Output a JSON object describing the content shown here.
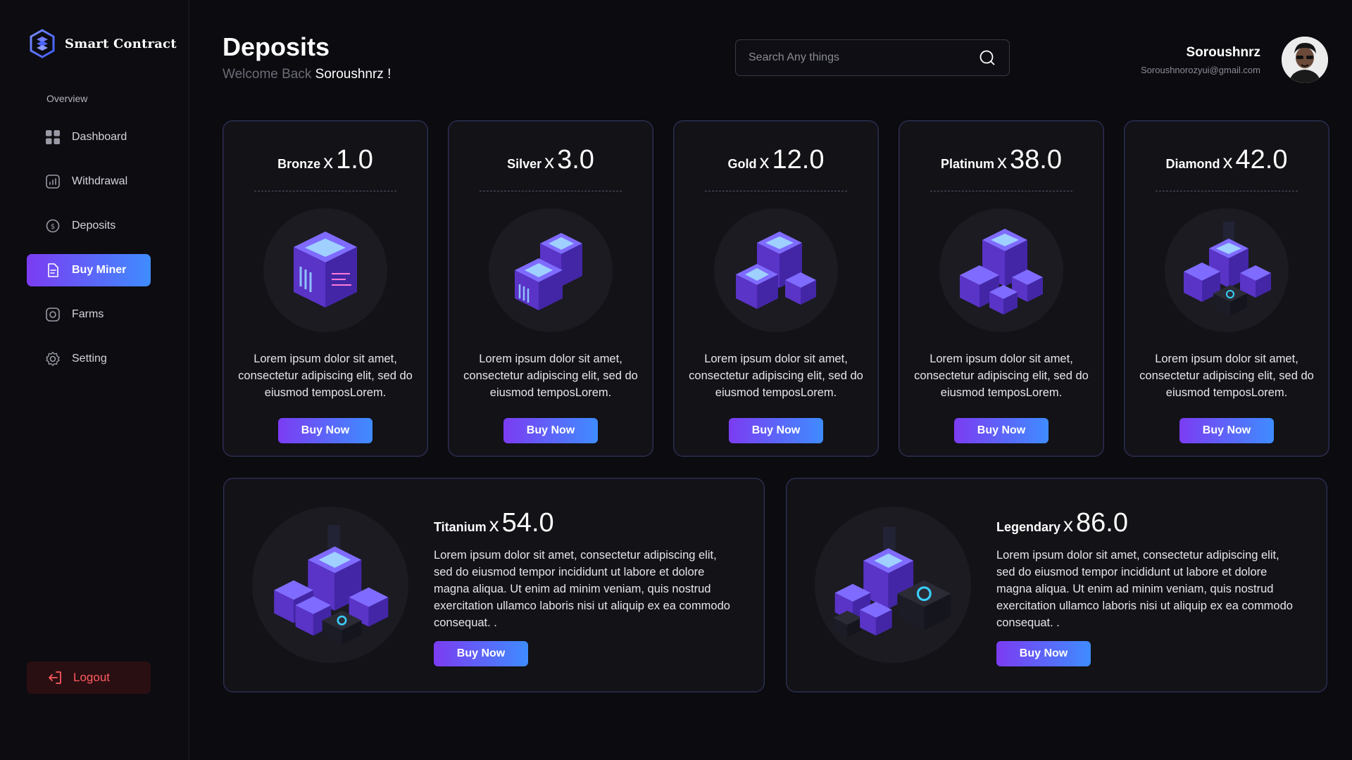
{
  "brand": {
    "name": "Smart Contract",
    "icon": "hexagon-logo-icon"
  },
  "sidebar": {
    "section_label": "Overview",
    "items": [
      {
        "label": "Dashboard",
        "icon": "grid-icon"
      },
      {
        "label": "Withdrawal",
        "icon": "chart-icon"
      },
      {
        "label": "Deposits",
        "icon": "coin-icon"
      },
      {
        "label": "Buy Miner",
        "icon": "document-icon",
        "active": true
      },
      {
        "label": "Farms",
        "icon": "target-icon"
      },
      {
        "label": "Setting",
        "icon": "gear-icon"
      }
    ],
    "logout_label": "Logout"
  },
  "header": {
    "title": "Deposits",
    "welcome_prefix": "Welcome Back",
    "welcome_name": "Soroushnrz !",
    "search_placeholder": "Search Any things"
  },
  "user": {
    "name": "Soroushnrz",
    "email": "Soroushnorozyui@gmail.com"
  },
  "tiers": [
    {
      "name": "Bronze",
      "x": "x",
      "mult": "1.0",
      "desc": "Lorem ipsum dolor sit amet, consectetur adipiscing elit, sed do eiusmod temposLorem.",
      "button": "Buy Now"
    },
    {
      "name": "Silver",
      "x": "x",
      "mult": "3.0",
      "desc": "Lorem ipsum dolor sit amet, consectetur adipiscing elit, sed do eiusmod temposLorem.",
      "button": "Buy Now"
    },
    {
      "name": "Gold",
      "x": "x",
      "mult": "12.0",
      "desc": "Lorem ipsum dolor sit amet, consectetur adipiscing elit, sed do eiusmod temposLorem.",
      "button": "Buy Now"
    },
    {
      "name": "Platinum",
      "x": "x",
      "mult": "38.0",
      "desc": "Lorem ipsum dolor sit amet, consectetur adipiscing elit, sed do eiusmod temposLorem.",
      "button": "Buy Now"
    },
    {
      "name": "Diamond",
      "x": "x",
      "mult": "42.0",
      "desc": "Lorem ipsum dolor sit amet, consectetur adipiscing elit, sed do eiusmod temposLorem.",
      "button": "Buy Now"
    }
  ],
  "wide_tiers": [
    {
      "name": "Titanium",
      "x": "x",
      "mult": "54.0",
      "desc": "Lorem ipsum dolor sit amet, consectetur adipiscing elit, sed do eiusmod tempor incididunt ut labore et dolore magna aliqua. Ut enim ad minim veniam, quis nostrud exercitation ullamco laboris nisi ut aliquip ex ea commodo consequat. .",
      "button": "Buy Now"
    },
    {
      "name": "Legendary",
      "x": "x",
      "mult": "86.0",
      "desc": "Lorem ipsum dolor sit amet, consectetur adipiscing elit, sed do eiusmod tempor incididunt ut labore et dolore magna aliqua. Ut enim ad minim veniam, quis nostrud exercitation ullamco laboris nisi ut aliquip ex ea commodo consequat. .",
      "button": "Buy Now"
    }
  ],
  "colors": {
    "accent_start": "#7b3cf2",
    "accent_end": "#3f8cff",
    "logout": "#ff5a5f",
    "background": "#0b0b10",
    "card": "#121217"
  }
}
